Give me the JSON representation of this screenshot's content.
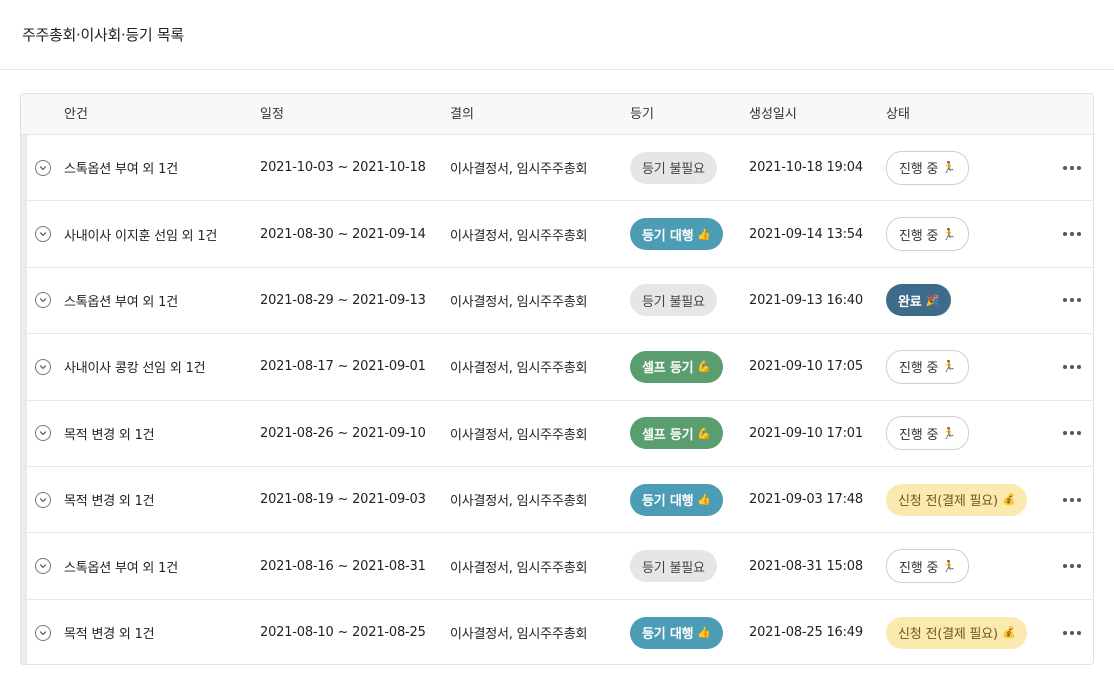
{
  "page": {
    "title": "주주총회·이사회·등기 목록"
  },
  "table": {
    "columns": [
      "안건",
      "일정",
      "결의",
      "등기",
      "생성일시",
      "상태"
    ],
    "rows": [
      {
        "title": "스톡옵션 부여 외 1건",
        "period": "2021-10-03 ~ 2021-10-18",
        "resolution": "이사결정서, 임시주주총회",
        "registration": "등기 불필요",
        "reg_type": "gray",
        "reg_emoji": "",
        "created": "2021-10-18 19:04",
        "status": "진행 중",
        "status_type": "outline",
        "status_emoji": "🏃"
      },
      {
        "title": "사내이사 이지훈 선임 외 1건",
        "period": "2021-08-30 ~ 2021-09-14",
        "resolution": "이사결정서, 임시주주총회",
        "registration": "등기 대행",
        "reg_type": "blue",
        "reg_emoji": "👍",
        "created": "2021-09-14 13:54",
        "status": "진행 중",
        "status_type": "outline",
        "status_emoji": "🏃"
      },
      {
        "title": "스톡옵션 부여 외 1건",
        "period": "2021-08-29 ~ 2021-09-13",
        "resolution": "이사결정서, 임시주주총회",
        "registration": "등기 불필요",
        "reg_type": "gray",
        "reg_emoji": "",
        "created": "2021-09-13 16:40",
        "status": "완료",
        "status_type": "done",
        "status_emoji": "🎉"
      },
      {
        "title": "사내이사 콩캉 선임 외 1건",
        "period": "2021-08-17 ~ 2021-09-01",
        "resolution": "이사결정서, 임시주주총회",
        "registration": "셀프 등기",
        "reg_type": "green",
        "reg_emoji": "💪",
        "created": "2021-09-10 17:05",
        "status": "진행 중",
        "status_type": "outline",
        "status_emoji": "🏃"
      },
      {
        "title": "목적 변경 외 1건",
        "period": "2021-08-26 ~ 2021-09-10",
        "resolution": "이사결정서, 임시주주총회",
        "registration": "셀프 등기",
        "reg_type": "green",
        "reg_emoji": "💪",
        "created": "2021-09-10 17:01",
        "status": "진행 중",
        "status_type": "outline",
        "status_emoji": "🏃"
      },
      {
        "title": "목적 변경 외 1건",
        "period": "2021-08-19 ~ 2021-09-03",
        "resolution": "이사결정서, 임시주주총회",
        "registration": "등기 대행",
        "reg_type": "blue",
        "reg_emoji": "👍",
        "created": "2021-09-03 17:48",
        "status": "신청 전(결제 필요)",
        "status_type": "pending",
        "status_emoji": "💰"
      },
      {
        "title": "스톡옵션 부여 외 1건",
        "period": "2021-08-16 ~ 2021-08-31",
        "resolution": "이사결정서, 임시주주총회",
        "registration": "등기 불필요",
        "reg_type": "gray",
        "reg_emoji": "",
        "created": "2021-08-31 15:08",
        "status": "진행 중",
        "status_type": "outline",
        "status_emoji": "🏃"
      },
      {
        "title": "목적 변경 외 1건",
        "period": "2021-08-10 ~ 2021-08-25",
        "resolution": "이사결정서, 임시주주총회",
        "registration": "등기 대행",
        "reg_type": "blue",
        "reg_emoji": "👍",
        "created": "2021-08-25 16:49",
        "status": "신청 전(결제 필요)",
        "status_type": "pending",
        "status_emoji": "💰"
      }
    ]
  },
  "colors": {
    "reg_gray": "#e6e6e6",
    "reg_blue": "#4d9cb5",
    "reg_green": "#5a9e6f",
    "status_done": "#3f6b8a",
    "status_pending": "#fbeab0"
  }
}
